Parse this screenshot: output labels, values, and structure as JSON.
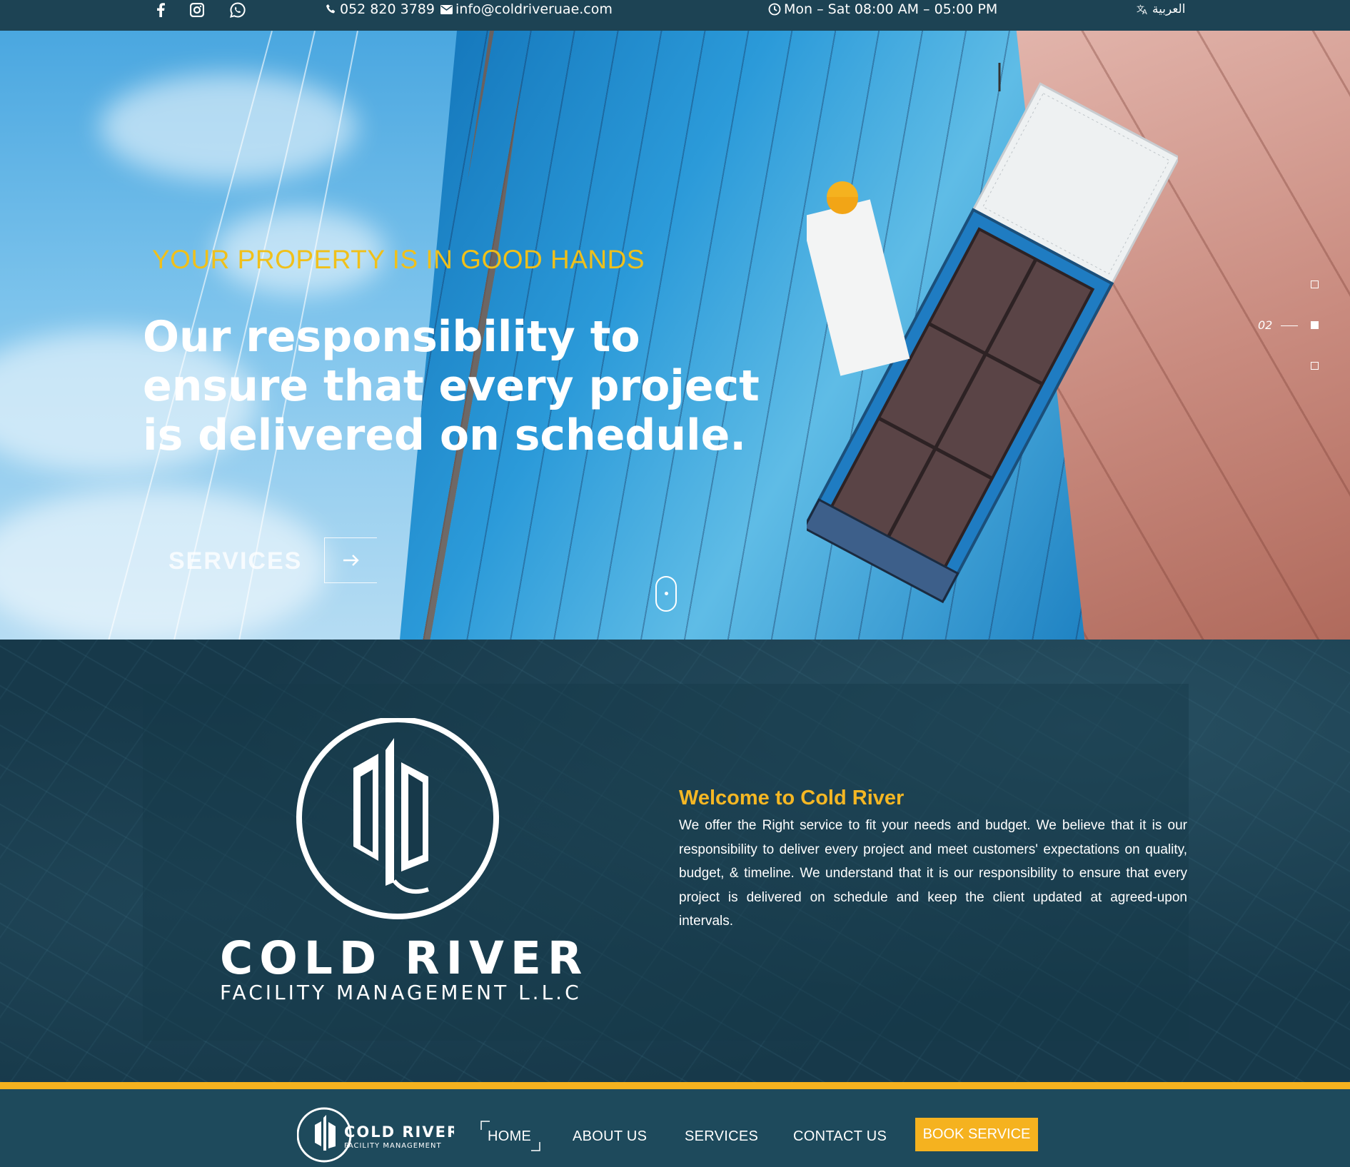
{
  "topbar": {
    "social": [
      "facebook-icon",
      "instagram-icon",
      "whatsapp-icon"
    ],
    "phone": "052 820 3789",
    "email": "info@coldriveruae.com",
    "hours": "Mon – Sat 08:00 AM – 05:00 PM",
    "language": "العربية"
  },
  "hero": {
    "tagline": "YOUR PROPERTY IS IN GOOD HANDS",
    "headline": "Our responsibility to ensure that every project is delivered on schedule.",
    "cta_label": "SERVICES",
    "slide_number": "02"
  },
  "welcome": {
    "brand_name": "COLD RIVER",
    "brand_sub": "FACILITY MANAGEMENT L.L.C",
    "title": "Welcome to Cold River",
    "body": "We offer the Right service to fit your needs and budget. We believe that it is our responsibility to deliver every project and meet customers' expectations on quality, budget, & timeline. We understand that it is our responsibility to ensure that every project is delivered on schedule and keep the client updated at agreed-upon intervals."
  },
  "nav": {
    "logo_name": "COLD RIVER",
    "logo_sub": "FACILITY MANAGEMENT",
    "items": [
      "HOME",
      "ABOUT US",
      "SERVICES",
      "CONTACT US"
    ],
    "book_label": "BOOK SERVICE"
  },
  "colors": {
    "topbar": "#1d4354",
    "accent": "#f5b21f",
    "tagline": "#f0c01a",
    "section_bg": "#17394a",
    "nav_bg": "#1e4a5c"
  }
}
